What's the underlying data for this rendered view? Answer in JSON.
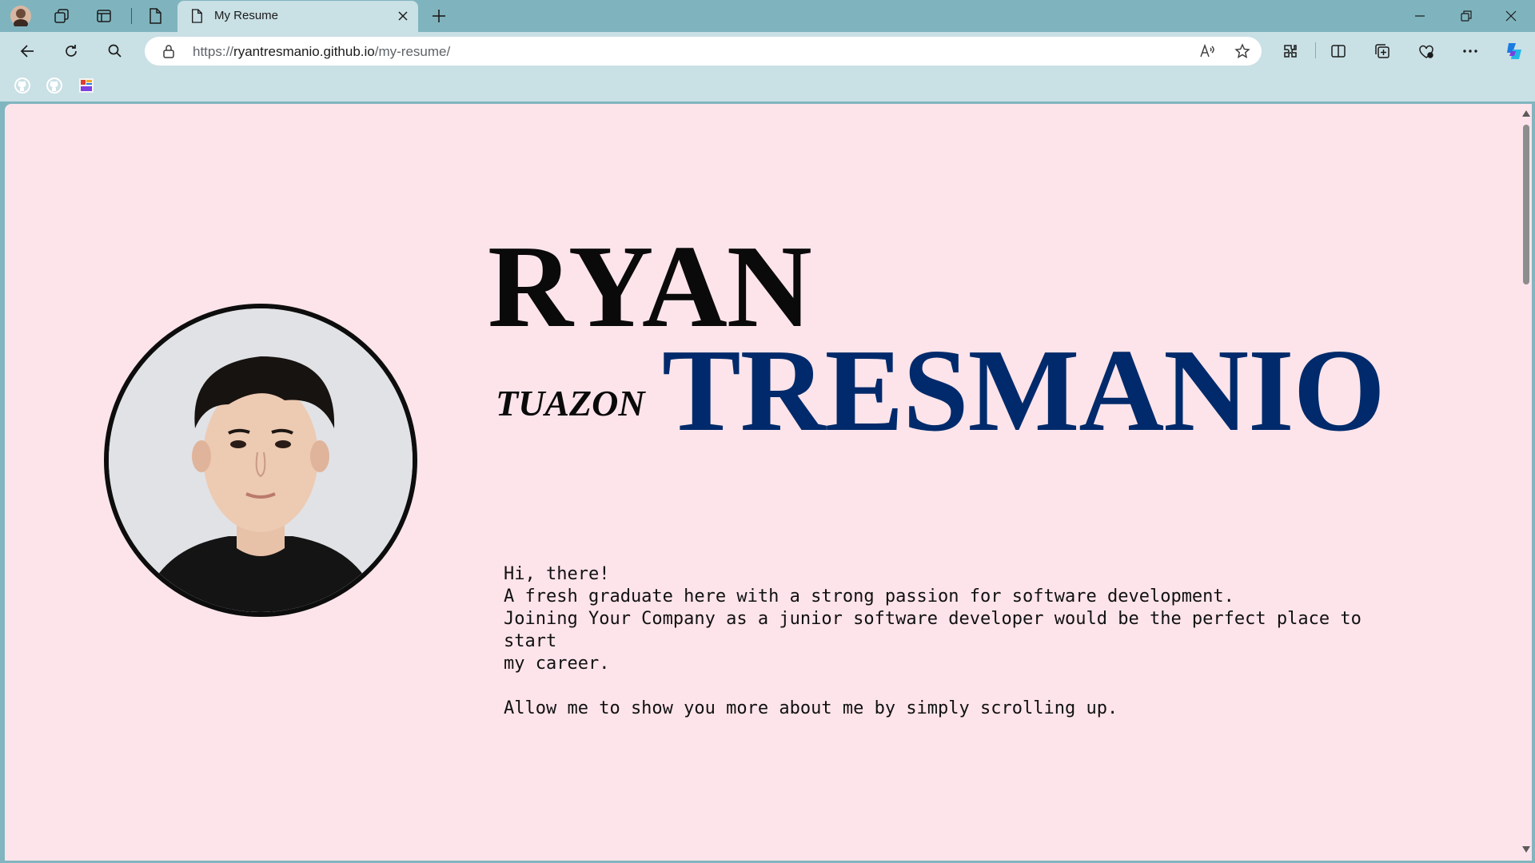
{
  "browser": {
    "tab_title": "My Resume",
    "url_scheme": "https://",
    "url_host": "ryantresmanio.github.io",
    "url_path": "/my-resume/"
  },
  "hero": {
    "first_name": "RYAN",
    "middle_name": "TUAZON",
    "last_name": "TRESMANIO"
  },
  "intro": {
    "line1": "Hi, there!",
    "line2": "A fresh graduate here with a strong passion for software development.",
    "line3": "Joining Your Company as a junior software developer would be the perfect place to",
    "line4": "start",
    "line5": "my career.",
    "line6": "",
    "line7": "Allow me to show you more about me by simply scrolling up."
  },
  "colors": {
    "page_background": "#fde4ea",
    "last_name": "#002a6b",
    "browser_frame": "#81b5bf"
  },
  "icons": {
    "bookmark_1": "github-icon",
    "bookmark_2": "github-icon",
    "bookmark_3": "app-icon"
  }
}
